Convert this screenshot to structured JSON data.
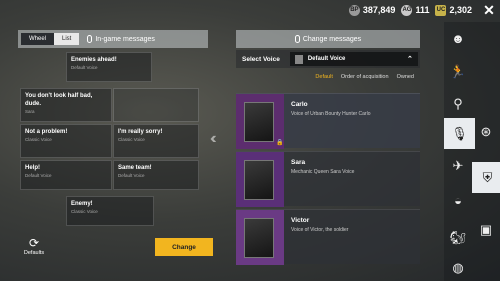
{
  "currency": {
    "bp": {
      "icon": "BP",
      "value": "387,849"
    },
    "ag": {
      "icon": "AG",
      "value": "111"
    },
    "uc": {
      "icon": "UC",
      "value": "2,302"
    }
  },
  "left": {
    "toggle_wheel": "Wheel",
    "toggle_list": "List",
    "title": "In-game messages",
    "slots": [
      {
        "title": "Enemies ahead!",
        "sub": "Default Voice"
      },
      {
        "title": "You don't look half bad, dude.",
        "sub": "Sara"
      },
      {
        "title": "Not a problem!",
        "sub": "Classic Voice"
      },
      {
        "title": "I'm really sorry!",
        "sub": "Classic Voice"
      },
      {
        "title": "Help!",
        "sub": "Default Voice"
      },
      {
        "title": "Same team!",
        "sub": "Default Voice"
      },
      {
        "title": "Enemy!",
        "sub": "Classic Voice"
      }
    ],
    "defaults_label": "Defaults",
    "change_label": "Change"
  },
  "right": {
    "title": "Change messages",
    "select_label": "Select Voice",
    "selected_voice": "Default Voice",
    "sorts": [
      "Default",
      "Order of acquisition",
      "Owned"
    ],
    "cards": [
      {
        "name": "Carlo",
        "desc": "Voice of Urban Bounty Hunter Carlo",
        "color": "#5c2d6e"
      },
      {
        "name": "Sara",
        "desc": "Mechanic Queen Sara Voice",
        "color": "#5a2f78"
      },
      {
        "name": "Victor",
        "desc": "Voice of Victor, the soldier",
        "color": "#6a3a84"
      }
    ]
  },
  "sidebar": {
    "icons": [
      "ghost-icon",
      "run-icon",
      "location-icon",
      "mic-icon",
      "steering-wheel-icon",
      "plane-icon",
      "parachute-icon",
      "helmet-icon",
      "crate-icon",
      "squirrel-icon",
      "balloon-icon"
    ]
  }
}
